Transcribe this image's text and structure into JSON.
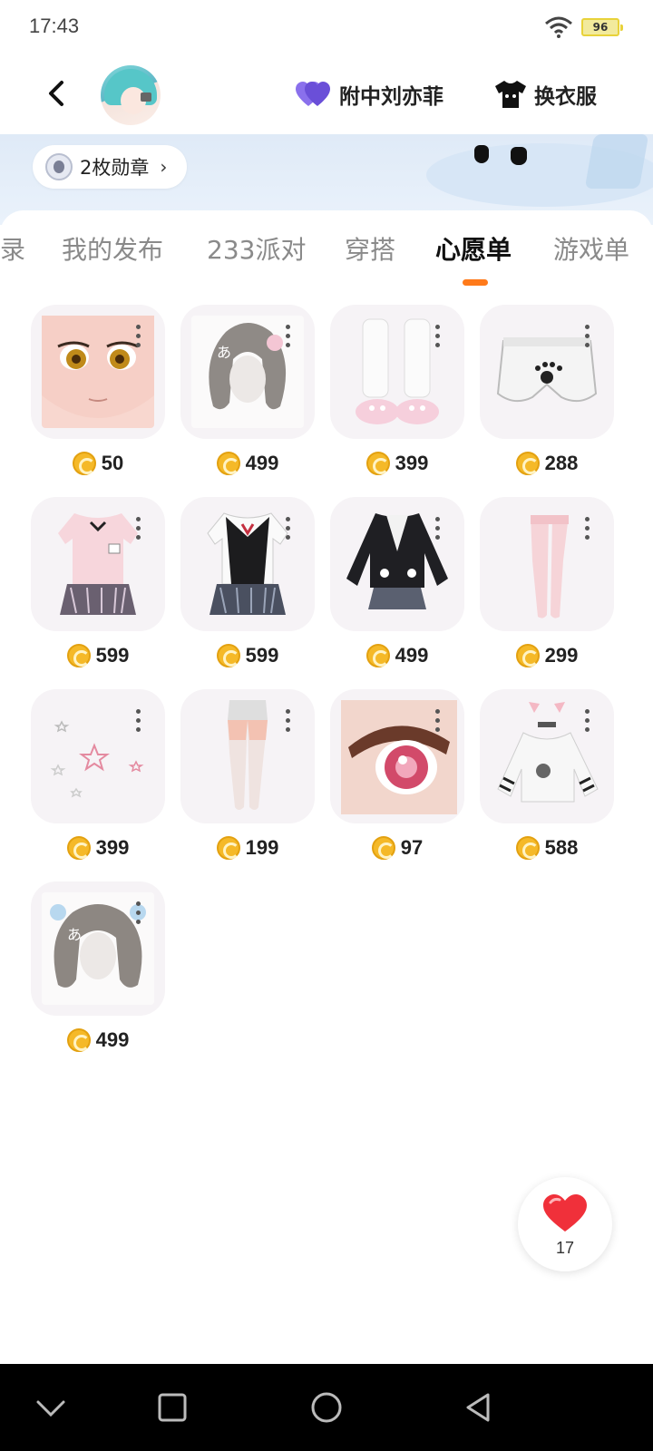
{
  "status_bar": {
    "time": "17:43",
    "battery": "96"
  },
  "header": {
    "favorite_label": "附中刘亦菲",
    "outfit_label": "换衣服",
    "icons": [
      "back-arrow",
      "avatar",
      "heart-double-icon",
      "tshirt-icon"
    ]
  },
  "banner": {
    "badge_text": "2枚勋章"
  },
  "tabs": [
    "录",
    "我的发布",
    "233派对",
    "穿搭",
    "心愿单",
    "游戏单"
  ],
  "active_tab": "心愿单",
  "wishlist": [
    {
      "name": "face",
      "price": "50"
    },
    {
      "name": "hair-bob",
      "price": "499"
    },
    {
      "name": "leg-warmers-slippers",
      "price": "399"
    },
    {
      "name": "paw-shorts",
      "price": "288"
    },
    {
      "name": "pink-uniform",
      "price": "599"
    },
    {
      "name": "black-vest-uniform",
      "price": "599"
    },
    {
      "name": "black-cardigan-uniform",
      "price": "499"
    },
    {
      "name": "pink-stockings",
      "price": "299"
    },
    {
      "name": "star-decor",
      "price": "399"
    },
    {
      "name": "white-tights",
      "price": "199"
    },
    {
      "name": "pink-eye",
      "price": "97"
    },
    {
      "name": "cat-hoodie",
      "price": "588"
    },
    {
      "name": "hair-twintails",
      "price": "499"
    }
  ],
  "like_fab": {
    "count": "17"
  },
  "colors": {
    "accent": "#ff7a1a",
    "coin": "#f5b928",
    "heart_purple": "#7b5fe0",
    "heart_red": "#f0303a"
  }
}
